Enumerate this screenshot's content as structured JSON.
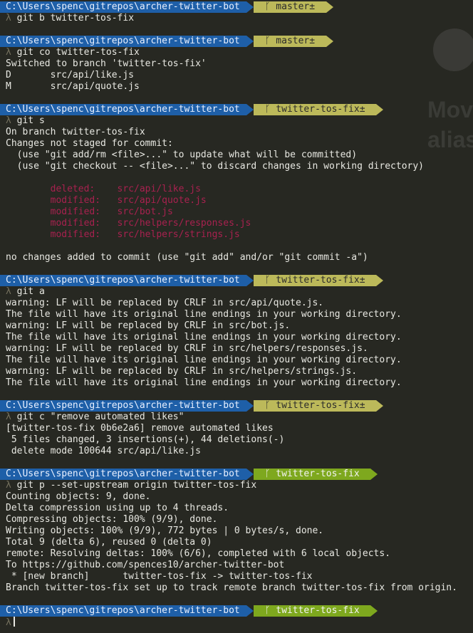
{
  "prompt_symbol": "λ",
  "background_window": {
    "title_fragment_1": "Mov",
    "title_fragment_2": "alias"
  },
  "blocks": [
    {
      "path": "C:\\Users\\spenc\\gitrepos\\archer-twitter-bot",
      "branch": "master±",
      "clean": false,
      "command": "git b twitter-tos-fix",
      "output": []
    },
    {
      "path": "C:\\Users\\spenc\\gitrepos\\archer-twitter-bot",
      "branch": "master±",
      "clean": false,
      "command": "git co twitter-tos-fix",
      "output": [
        {
          "text": "Switched to branch 'twitter-tos-fix'"
        },
        {
          "text": "D       src/api/like.js"
        },
        {
          "text": "M       src/api/quote.js"
        }
      ]
    },
    {
      "path": "C:\\Users\\spenc\\gitrepos\\archer-twitter-bot",
      "branch": "twitter-tos-fix±",
      "clean": false,
      "command": "git s",
      "output": [
        {
          "text": "On branch twitter-tos-fix"
        },
        {
          "text": "Changes not staged for commit:"
        },
        {
          "text": "  (use \"git add/rm <file>...\" to update what will be committed)"
        },
        {
          "text": "  (use \"git checkout -- <file>...\" to discard changes in working directory)"
        },
        {
          "text": ""
        },
        {
          "text": "        deleted:    src/api/like.js",
          "style": "red"
        },
        {
          "text": "        modified:   src/api/quote.js",
          "style": "red"
        },
        {
          "text": "        modified:   src/bot.js",
          "style": "red"
        },
        {
          "text": "        modified:   src/helpers/responses.js",
          "style": "red"
        },
        {
          "text": "        modified:   src/helpers/strings.js",
          "style": "red"
        },
        {
          "text": ""
        },
        {
          "text": "no changes added to commit (use \"git add\" and/or \"git commit -a\")"
        }
      ]
    },
    {
      "path": "C:\\Users\\spenc\\gitrepos\\archer-twitter-bot",
      "branch": "twitter-tos-fix±",
      "clean": false,
      "command": "git a",
      "output": [
        {
          "text": "warning: LF will be replaced by CRLF in src/api/quote.js."
        },
        {
          "text": "The file will have its original line endings in your working directory."
        },
        {
          "text": "warning: LF will be replaced by CRLF in src/bot.js."
        },
        {
          "text": "The file will have its original line endings in your working directory."
        },
        {
          "text": "warning: LF will be replaced by CRLF in src/helpers/responses.js."
        },
        {
          "text": "The file will have its original line endings in your working directory."
        },
        {
          "text": "warning: LF will be replaced by CRLF in src/helpers/strings.js."
        },
        {
          "text": "The file will have its original line endings in your working directory."
        }
      ]
    },
    {
      "path": "C:\\Users\\spenc\\gitrepos\\archer-twitter-bot",
      "branch": "twitter-tos-fix±",
      "clean": false,
      "command": "git c \"remove automated likes\"",
      "output": [
        {
          "text": "[twitter-tos-fix 0b6e2a6] remove automated likes"
        },
        {
          "text": " 5 files changed, 3 insertions(+), 44 deletions(-)"
        },
        {
          "text": " delete mode 100644 src/api/like.js"
        }
      ]
    },
    {
      "path": "C:\\Users\\spenc\\gitrepos\\archer-twitter-bot",
      "branch": "twitter-tos-fix",
      "clean": true,
      "command": "git p --set-upstream origin twitter-tos-fix",
      "output": [
        {
          "text": "Counting objects: 9, done."
        },
        {
          "text": "Delta compression using up to 4 threads."
        },
        {
          "text": "Compressing objects: 100% (9/9), done."
        },
        {
          "text": "Writing objects: 100% (9/9), 772 bytes | 0 bytes/s, done."
        },
        {
          "text": "Total 9 (delta 6), reused 0 (delta 0)"
        },
        {
          "text": "remote: Resolving deltas: 100% (6/6), completed with 6 local objects."
        },
        {
          "text": "To https://github.com/spences10/archer-twitter-bot"
        },
        {
          "text": " * [new branch]      twitter-tos-fix -> twitter-tos-fix"
        },
        {
          "text": "Branch twitter-tos-fix set up to track remote branch twitter-tos-fix from origin."
        }
      ]
    },
    {
      "path": "C:\\Users\\spenc\\gitrepos\\archer-twitter-bot",
      "branch": "twitter-tos-fix",
      "clean": true,
      "command": "",
      "output": [],
      "active": true
    }
  ]
}
